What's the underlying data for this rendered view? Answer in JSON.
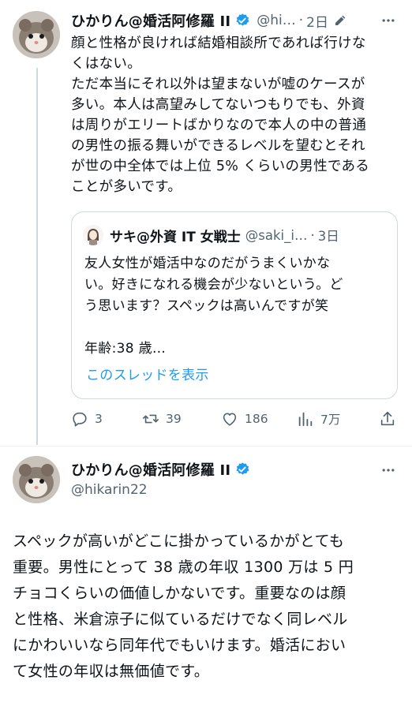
{
  "tweet1": {
    "display_name": "ひかりん@婚活阿修羅 II",
    "handle": "@hi…",
    "dot": "·",
    "time": "2日",
    "text": "顔と性格が良ければ結婚相談所であれば行けな\nくはない。\nただ本当にそれ以外は望まないが嘘のケースが\n多い。本人は高望みしてないつもりでも、外資\nは周りがエリートばかりなので本人の中の普通\nの男性の振る舞いができるレベルを望むとそれ\nが世の中全体では上位 5% くらいの男性である\nことが多いです。",
    "quote": {
      "display_name": "サキ@外資 IT 女戦士",
      "handle": "@saki_i…",
      "dot": "·",
      "time": "3日",
      "text": "友人女性が婚活中なのだがうまくいかな\nい。好きになれる機会が少ないという。ど\nう思います？スペックは高いんですが笑\n\n年齢:38 歳…",
      "show_thread": "このスレッドを表示"
    },
    "actions": {
      "replies": "3",
      "retweets": "39",
      "likes": "186",
      "views": "7万"
    }
  },
  "tweet2": {
    "display_name": "ひかりん@婚活阿修羅 II",
    "handle": "@hikarin22",
    "text": "スペックが高いがどこに掛かっているかがとても\n重要。男性にとって 38 歳の年収 1300 万は 5 円\nチョコくらいの価値しかないです。重要なのは顔\nと性格、米倉涼子に似ているだけでなく同レベル\nにかわいいなら同年代でもいけます。婚活におい\nて女性の年収は無価値です。"
  },
  "icons": {
    "verified": "verified-badge-icon",
    "edit": "edit-pencil-icon",
    "more": "more-dots-icon",
    "reply": "reply-icon",
    "retweet": "retweet-icon",
    "like": "heart-icon",
    "views": "views-chart-icon",
    "share": "share-icon"
  },
  "colors": {
    "accent": "#1d9bf0",
    "text": "#0f1419",
    "secondary": "#536471",
    "border": "#cfd9de"
  }
}
